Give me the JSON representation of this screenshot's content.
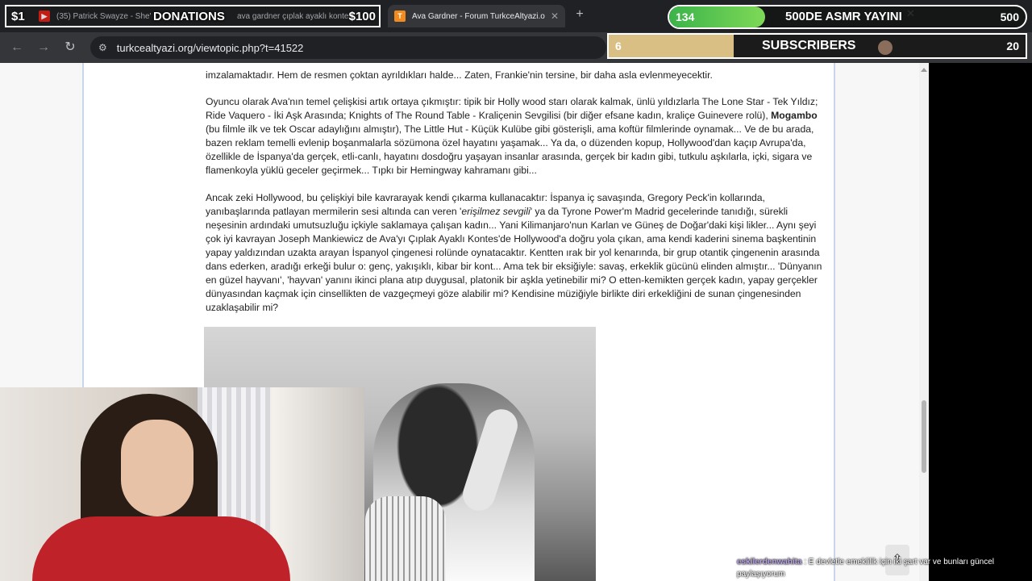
{
  "browser": {
    "tabs": [
      {
        "label": "(35) Patrick Swayze - She's Lik",
        "icon": "youtube-icon"
      },
      {
        "label": "ava gardner çıplak ayaklı kontes",
        "icon": "google-icon"
      },
      {
        "label": "Ava Gardner - Forum TurkceAltyazi.o",
        "icon": "forum-icon",
        "favicon_text": "T"
      }
    ],
    "new_tab_symbol": "+",
    "url": "turkcealtyazi.org/viewtopic.php?t=41522"
  },
  "overlay": {
    "donations": {
      "min": "$1",
      "label": "DONATIONS",
      "max": "$100"
    },
    "goal_asmr": {
      "current": "134",
      "title": "500DE ASMR YAYINI",
      "max": "500",
      "progress": 0.27
    },
    "goal_subs": {
      "current": "6",
      "title": "SUBSCRIBERS",
      "max": "20",
      "progress": 0.3
    },
    "chat": {
      "user": "eskilerdenwahita",
      "message": ": E devletle emeklilik için iki şart var ve bunları güncel paylaşıyorum"
    }
  },
  "article": {
    "p0": "imzalamaktadır. Hem de resmen çoktan ayrıldıkları halde... Zaten, Frankie'nin tersine, bir daha asla evlenmeyecektir.",
    "p1_a": "Oyuncu olarak Ava'nın temel çelişkisi artık ortaya çıkmıştır: tipik bir Holly wood starı olarak kalmak, ünlü yıldızlarla The Lone Star - Tek Yıldız; Ride Vaquero - İki Aşk Arasında; Knights of The Round Table - Kraliçenin Sevgilisi (bir diğer efsane kadın, kraliçe Guinevere rolü), ",
    "p1_bold": "Mogambo",
    "p1_b": " (bu filmle ilk ve tek Oscar adaylığını almıştır), The Little Hut - Küçük Kulübe gibi gösterişli, ama koftür filmlerinde oynamak... Ve de bu arada, bazen reklam temelli evlenip boşanmalarla sözümona özel hayatını yaşamak... Ya da, o düzenden kopup, Hollywood'dan kaçıp Avrupa'da, özellikle de İspanya'da gerçek, etli-canlı, hayatını dosdoğru yaşayan insanlar arasında, gerçek bir kadın gibi, tutkulu aşkılarla, içki, sigara ve flamenkoyla yüklü geceler geçirmek... Tıpkı bir Hemingway kahramanı gibi...",
    "p2_a": "Ancak zeki Hollywood, bu çelişkiyi bile kavrarayak kendi çıkarma kullanacaktır: İspanya iç savaşında, Gregory Peck'in kollarında, yanıbaşlarında patlayan mermilerin sesi altında can veren '",
    "p2_italic": "erişilmez sevgili",
    "p2_b": "' ya da Tyrone Power'm Madrid gecelerinde tanıdığı, sürekli neşesinin ardındaki umutsuzluğu içkiyle saklamaya çalışan kadın... Yani Kilimanjaro'nun Karlan ve Güneş de Doğar'daki kişi likler... Aynı şeyi çok iyi kavrayan Joseph Mankiewicz de Ava'yı Çıplak Ayaklı Kontes'de Hollywood'a doğru yola çıkan, ama kendi kaderini sinema başkentinin yapay yaldızından uzakta arayan İspanyol çingenesi rolünde oynatacaktır. Kentten ırak bir yol kenarında, bir grup otantik çingenenin arasında dans ederken, aradığı erkeği bulur o: genç, yakışıklı, kibar bir kont... Ama tek bir eksiğiyle: savaş, erkeklik gücünü elinden almıştır... 'Dünyanın en güzel hayvanı', 'hayvan' yanını ikinci plana atıp duygusal, platonik bir aşkla yetinebilir mi? O etten-kemikten gerçek kadın, yapay gerçekler dünyasından kaçmak için cinsellikten de vazgeçmeyi göze alabilir mi? Kendisine müziğiyle birlikte diri erkekliğini de sunan çingenesinden uzaklaşabilir mi?"
  },
  "colors": {
    "goal_green": "#3bb34a",
    "goal_gold": "#d9bf84",
    "link_blue": "#c8d6e8"
  }
}
